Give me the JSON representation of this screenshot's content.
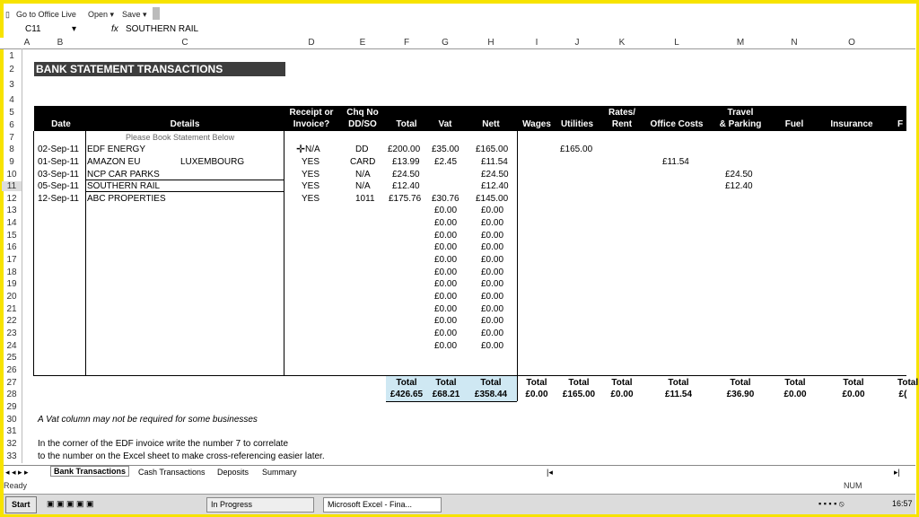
{
  "toolbar": {
    "office_live": "Go to Office Live",
    "open": "Open ▾",
    "save": "Save ▾"
  },
  "formula_bar": {
    "cell_ref": "C11",
    "fx": "fx",
    "value": "SOUTHERN RAIL"
  },
  "columns": [
    "A",
    "B",
    "C",
    "D",
    "E",
    "F",
    "G",
    "H",
    "I",
    "J",
    "K",
    "L",
    "M",
    "N",
    "O"
  ],
  "sheet": {
    "title": "BANK STATEMENT TRANSACTIONS",
    "headers": {
      "date": "Date",
      "details": "Details",
      "receipt_1": "Receipt or",
      "receipt_2": "Invoice?",
      "chq_1": "Chq No",
      "chq_2": "DD/SO",
      "total": "Total",
      "vat": "Vat",
      "nett": "Nett",
      "wages": "Wages",
      "utilities": "Utilities",
      "rates_1": "Rates/",
      "rates_2": "Rent",
      "office": "Office Costs",
      "travel_1": "Travel",
      "travel_2": "& Parking",
      "fuel": "Fuel",
      "insurance": "Insurance",
      "extra": "F"
    },
    "placeholder": "Please Book Statement Below",
    "transactions": [
      {
        "date": "02-Sep-11",
        "details": "EDF ENERGY",
        "extra": "",
        "receipt": "N/A",
        "chq": "DD",
        "total": "£200.00",
        "vat": "£35.00",
        "nett": "£165.00",
        "utilities": "£165.00",
        "office": "",
        "travel": ""
      },
      {
        "date": "01-Sep-11",
        "details": "AMAZON EU",
        "extra": "LUXEMBOURG",
        "receipt": "YES",
        "chq": "CARD",
        "total": "£13.99",
        "vat": "£2.45",
        "nett": "£11.54",
        "utilities": "",
        "office": "£11.54",
        "travel": ""
      },
      {
        "date": "03-Sep-11",
        "details": "NCP CAR PARKS",
        "extra": "",
        "receipt": "YES",
        "chq": "N/A",
        "total": "£24.50",
        "vat": "",
        "nett": "£24.50",
        "utilities": "",
        "office": "",
        "travel": "£24.50"
      },
      {
        "date": "05-Sep-11",
        "details": "SOUTHERN RAIL",
        "extra": "",
        "receipt": "YES",
        "chq": "N/A",
        "total": "£12.40",
        "vat": "",
        "nett": "£12.40",
        "utilities": "",
        "office": "",
        "travel": "£12.40"
      },
      {
        "date": "12-Sep-11",
        "details": "ABC PROPERTIES",
        "extra": "",
        "receipt": "YES",
        "chq": "1011",
        "total": "£175.76",
        "vat": "£30.76",
        "nett": "£145.00",
        "utilities": "",
        "office": "",
        "travel": ""
      }
    ],
    "zero_value": "£0.00",
    "totals": {
      "label": "Total",
      "total": "£426.65",
      "vat": "£68.21",
      "nett": "£358.44",
      "wages": "£0.00",
      "utilities": "£165.00",
      "rates": "£0.00",
      "office": "£11.54",
      "travel": "£36.90",
      "fuel": "£0.00",
      "insurance": "£0.00",
      "extra": "£("
    },
    "notes": [
      "A Vat column may not be required for some businesses",
      "In the corner of the EDF invoice write the number 7 to correlate",
      "to the number on the Excel sheet to make cross-referencing easier later."
    ]
  },
  "sheet_tabs": [
    "Bank Transactions",
    "Cash Transactions",
    "Deposits",
    "Summary"
  ],
  "status": {
    "ready": "Ready",
    "num": "NUM"
  },
  "taskbar": {
    "start": "Start",
    "in_progress": "In Progress",
    "excel": "Microsoft Excel - Fina...",
    "clock": "16:57"
  }
}
